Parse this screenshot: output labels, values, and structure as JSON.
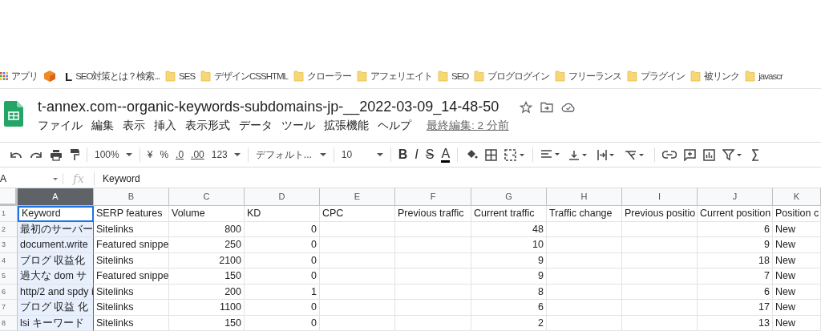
{
  "bookmarks_bar": {
    "items": [
      {
        "kind": "apps",
        "label": "アプリ"
      },
      {
        "kind": "cube"
      },
      {
        "kind": "letter",
        "icon_text": "L",
        "label": "SEO対策とは？検索..."
      },
      {
        "kind": "folder",
        "label": "SES"
      },
      {
        "kind": "folder",
        "label": "デザインCSSHTML"
      },
      {
        "kind": "folder",
        "label": "クローラー"
      },
      {
        "kind": "folder",
        "label": "アフェリエイト"
      },
      {
        "kind": "folder",
        "label": "SEO"
      },
      {
        "kind": "folder",
        "label": "ブログログイン"
      },
      {
        "kind": "folder",
        "label": "フリーランス"
      },
      {
        "kind": "folder",
        "label": "プラグイン"
      },
      {
        "kind": "folder",
        "label": "被リンク"
      },
      {
        "kind": "folder",
        "label": "javascr"
      }
    ]
  },
  "document": {
    "title": "t-annex.com--organic-keywords-subdomains-jp-__2022-03-09_14-48-50",
    "menu": [
      "ファイル",
      "編集",
      "表示",
      "挿入",
      "表示形式",
      "データ",
      "ツール",
      "拡張機能",
      "ヘルプ"
    ],
    "last_edit": "最終編集: 2 分前"
  },
  "toolbar": {
    "zoom": "100%",
    "currency": "¥",
    "percent": "%",
    "decrease_decimals": ".0",
    "increase_decimals": ".00",
    "number_format": "123",
    "font": "デフォルト...",
    "font_size": "10",
    "bold": "B",
    "italic": "I",
    "strikethrough": "S",
    "text_color": "A"
  },
  "formula_bar": {
    "cell_ref": "A",
    "fx": "fx",
    "value": "Keyword"
  },
  "sheet": {
    "columns": [
      {
        "label": "A",
        "selected": true,
        "kind": "text"
      },
      {
        "label": "B",
        "selected": false,
        "kind": "text"
      },
      {
        "label": "C",
        "selected": false,
        "kind": "number"
      },
      {
        "label": "D",
        "selected": false,
        "kind": "number"
      },
      {
        "label": "E",
        "selected": false
      },
      {
        "label": "F",
        "selected": false
      },
      {
        "label": "G",
        "selected": false,
        "kind": "number"
      },
      {
        "label": "H",
        "selected": false
      },
      {
        "label": "I",
        "selected": false
      },
      {
        "label": "J",
        "selected": false,
        "kind": "number"
      },
      {
        "label": "K",
        "selected": false,
        "kind": "text"
      }
    ],
    "rows": [
      {
        "number": "1",
        "kind": "header",
        "cells": [
          "Keyword",
          "SERP features",
          "Volume",
          "KD",
          "CPC",
          "Previous traffic",
          "Current traffic",
          "Traffic change",
          "Previous positio",
          "Current position",
          "Position c"
        ]
      },
      {
        "number": "2",
        "kind": "data",
        "cells": [
          "最初のサーバー",
          "Sitelinks",
          "800",
          "0",
          "",
          "",
          "48",
          "",
          "",
          "6",
          "New"
        ]
      },
      {
        "number": "3",
        "kind": "data",
        "cells": [
          "document.write",
          "Featured snippe",
          "250",
          "0",
          "",
          "",
          "10",
          "",
          "",
          "9",
          "New"
        ]
      },
      {
        "number": "4",
        "kind": "data",
        "cells": [
          "ブログ 収益化",
          "Sitelinks",
          "2100",
          "0",
          "",
          "",
          "9",
          "",
          "",
          "18",
          "New"
        ]
      },
      {
        "number": "5",
        "kind": "data",
        "cells": [
          "過大な dom サ",
          "Featured snippe",
          "150",
          "0",
          "",
          "",
          "9",
          "",
          "",
          "7",
          "New"
        ]
      },
      {
        "number": "6",
        "kind": "data",
        "cells": [
          "http/2 and spdy i",
          "Sitelinks",
          "200",
          "1",
          "",
          "",
          "8",
          "",
          "",
          "6",
          "New"
        ]
      },
      {
        "number": "7",
        "kind": "data",
        "cells": [
          "ブログ 収益 化",
          "Sitelinks",
          "1100",
          "0",
          "",
          "",
          "6",
          "",
          "",
          "17",
          "New"
        ]
      },
      {
        "number": "8",
        "kind": "data",
        "cells": [
          "lsi キーワード",
          "Sitelinks",
          "150",
          "0",
          "",
          "",
          "2",
          "",
          "",
          "13",
          "New"
        ]
      }
    ]
  }
}
